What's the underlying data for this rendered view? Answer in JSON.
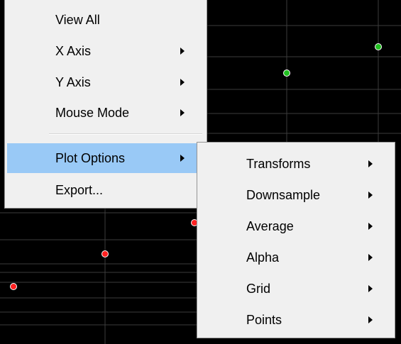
{
  "plot": {
    "background": "#000000",
    "gridline_color": "#3c3c3c",
    "markers": [
      {
        "series": "green",
        "color": "#20c020"
      },
      {
        "series": "green",
        "color": "#20c020"
      },
      {
        "series": "red",
        "color": "#ff2020"
      },
      {
        "series": "red",
        "color": "#ff2020"
      },
      {
        "series": "red",
        "color": "#ff2020"
      }
    ]
  },
  "context_menu": {
    "items": [
      {
        "label": "View All",
        "has_submenu": false
      },
      {
        "label": "X Axis",
        "has_submenu": true
      },
      {
        "label": "Y Axis",
        "has_submenu": true
      },
      {
        "label": "Mouse Mode",
        "has_submenu": true
      },
      {
        "label": "Plot Options",
        "has_submenu": true,
        "highlighted": true
      },
      {
        "label": "Export...",
        "has_submenu": false
      }
    ],
    "highlight_color": "#99c9f6"
  },
  "plot_options_submenu": {
    "items": [
      {
        "label": "Transforms",
        "has_submenu": true
      },
      {
        "label": "Downsample",
        "has_submenu": true
      },
      {
        "label": "Average",
        "has_submenu": true
      },
      {
        "label": "Alpha",
        "has_submenu": true
      },
      {
        "label": "Grid",
        "has_submenu": true
      },
      {
        "label": "Points",
        "has_submenu": true
      }
    ]
  }
}
